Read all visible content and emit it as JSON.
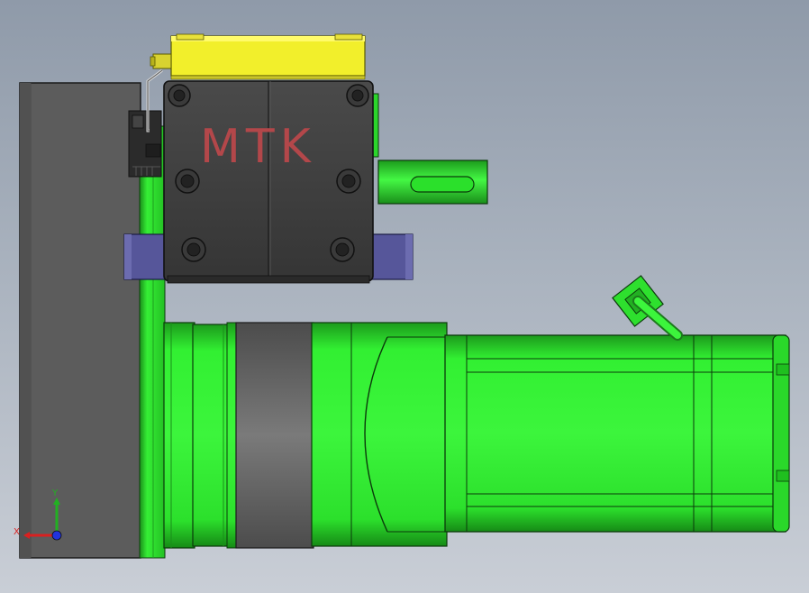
{
  "viewport": {
    "background_top": "#8f9aa9",
    "background_bottom": "#c9ced6"
  },
  "model": {
    "logo_text": "MTK",
    "logo_color": "#b3474a",
    "part_colors": {
      "motor_green": "#2eea2e",
      "motor_green_dark": "#1b9a1b",
      "gearbox_dark": "#3f3f3f",
      "base_plate": "#5e5e5e",
      "bracket_blue": "#5a5a9c",
      "sensor_yellow": "#f2ef2b",
      "collar_gray": "#6b6b6b"
    }
  },
  "triad": {
    "x_label": "X",
    "y_label": "Y",
    "x_color": "#d92020",
    "y_color": "#22b022",
    "z_color": "#2233dd"
  }
}
